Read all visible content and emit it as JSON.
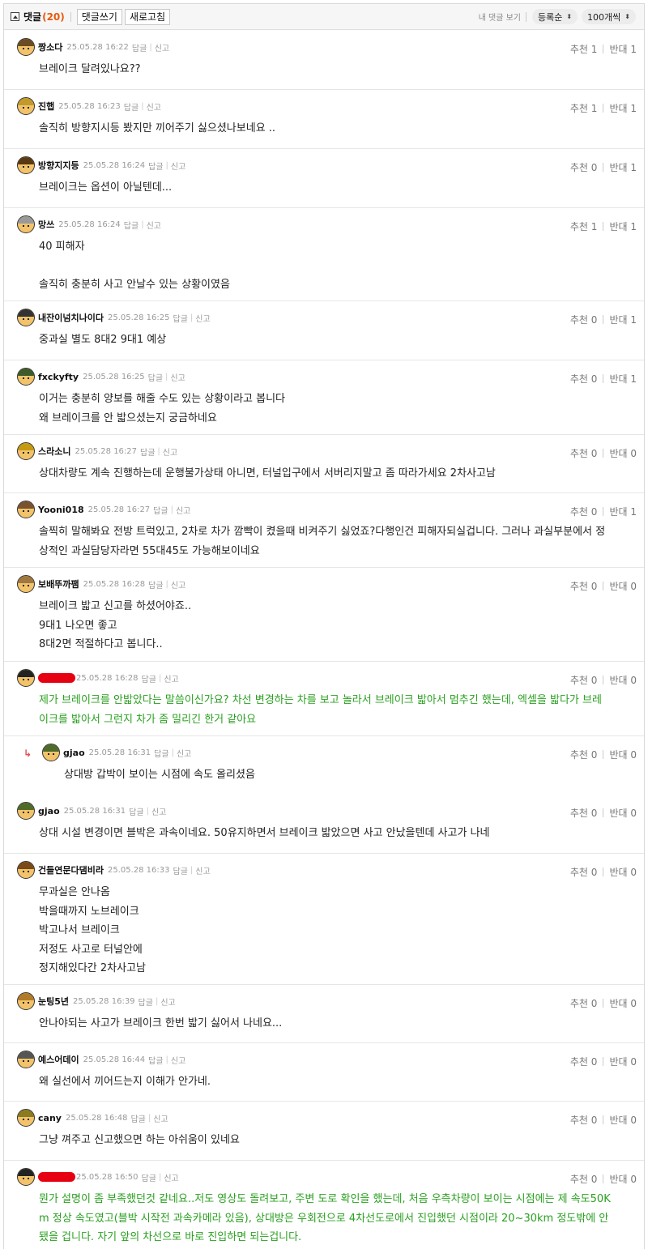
{
  "header": {
    "title": "댓글",
    "count": "(20)",
    "write_btn": "댓글쓰기",
    "refresh_btn": "새로고침",
    "my_comments": "내 댓글 보기",
    "sort_select": "등록순",
    "per_page_select": "100개씩"
  },
  "labels": {
    "reply": "답글",
    "report": "신고",
    "up": "추천",
    "down": "반대"
  },
  "colors": {
    "count": "#e8590c",
    "author_highlight": "#2aa020",
    "redacted": "#e60012"
  },
  "comments": [
    {
      "nick": "짱소다",
      "date": "25.05.28 16:22",
      "up": "1",
      "down": "1",
      "lines": [
        "브레이크 달려있나요??"
      ]
    },
    {
      "nick": "진햅",
      "date": "25.05.28 16:23",
      "up": "1",
      "down": "1",
      "lines": [
        "솔직히 방향지시등 봤지만 끼어주기 싫으셨나보네요 .."
      ]
    },
    {
      "nick": "방향지지등",
      "date": "25.05.28 16:24",
      "up": "0",
      "down": "1",
      "lines": [
        "브레이크는 옵션이 아닐텐데..."
      ]
    },
    {
      "nick": "망쓰",
      "date": "25.05.28 16:24",
      "up": "1",
      "down": "1",
      "lines": [
        "40 피해자",
        "",
        "솔직히 충분히 사고 안날수 있는 상황이였음"
      ]
    },
    {
      "nick": "내잔이넘치나이다",
      "date": "25.05.28 16:25",
      "up": "0",
      "down": "1",
      "lines": [
        "중과실 별도 8대2 9대1 예상"
      ]
    },
    {
      "nick": "fxckyfty",
      "date": "25.05.28 16:25",
      "up": "0",
      "down": "1",
      "lines": [
        "이거는 충분히 양보를 해줄 수도 있는 상황이라고 봅니다",
        "왜 브레이크를 안 밟으셨는지 궁금하네요"
      ]
    },
    {
      "nick": "스라소니",
      "date": "25.05.28 16:27",
      "up": "0",
      "down": "0",
      "lines": [
        "상대차량도 계속 진행하는데 운행불가상태 아니면, 터널입구에서 서버리지말고 좀 따라가세요 2차사고남"
      ]
    },
    {
      "nick": "Yooni018",
      "date": "25.05.28 16:27",
      "up": "0",
      "down": "1",
      "lines": [
        "솔찍히 말해봐요 전방 트럭있고, 2차로 차가 깜빡이 켰을때 비켜주기 싫었죠?다행인건 피해자되실겁니다. 그러나 과실부분에서 정",
        "상적인 과실담당자라면 55대45도 가능해보이네요"
      ]
    },
    {
      "nick": "보배뚜까팸",
      "date": "25.05.28 16:28",
      "up": "0",
      "down": "0",
      "lines": [
        "브레이크 밟고 신고를 하셨어야죠..",
        "9대1 나오면 좋고",
        "8대2면 적절하다고 봅니다.."
      ]
    },
    {
      "nick": "",
      "date": "25.05.28 16:28",
      "up": "0",
      "down": "0",
      "lines": [
        "제가 브레이크를 안밟았다는 말씀이신가요? 차선 변경하는 차를 보고 놀라서 브레이크 밟아서 멈추긴 했는데, 엑셀을 밟다가 브레",
        "이크를 밟아서 그런지 차가 좀 밀리긴 한거 같아요"
      ]
    },
    {
      "nick": "gjao",
      "date": "25.05.28 16:31",
      "up": "0",
      "down": "0",
      "lines": [
        "상대방 갑박이 보이는 시점에 속도 올리셨음"
      ]
    },
    {
      "nick": "gjao",
      "date": "25.05.28 16:31",
      "up": "0",
      "down": "0",
      "lines": [
        "상대 시설 변경이면 블박은 과속이네요. 50유지하면서 브레이크 밟았으면 사고 안났을텐데 사고가 나네"
      ]
    },
    {
      "nick": "건들연문다댐비라",
      "date": "25.05.28 16:33",
      "up": "0",
      "down": "0",
      "lines": [
        "무과실은 안나옴",
        "박을때까지 노브레이크",
        "박고나서 브레이크",
        "저정도 사고로 터널안에",
        "정지해있다간 2차사고남"
      ]
    },
    {
      "nick": "눈팅5년",
      "date": "25.05.28 16:39",
      "up": "0",
      "down": "0",
      "lines": [
        "안나야되는 사고가 브레이크 한번 밟기 싫어서 나네요..."
      ]
    },
    {
      "nick": "예스어데이",
      "date": "25.05.28 16:44",
      "up": "0",
      "down": "0",
      "lines": [
        "왜 실선에서 끼어드는지 이해가 안가네."
      ]
    },
    {
      "nick": "cany",
      "date": "25.05.28 16:48",
      "up": "0",
      "down": "0",
      "lines": [
        "그냥 껴주고 신고했으면 하는 아쉬움이 있네요"
      ]
    },
    {
      "nick": "",
      "date": "25.05.28 16:50",
      "up": "0",
      "down": "0",
      "lines": [
        "뭔가 설명이 좀 부족했던것 같네요..저도 영상도 돌려보고, 주변 도로 확인을 했는데, 처음 우측차량이 보이는 시점에는 제 속도50K",
        "m 정상 속도였고(블박 시작전 과속카메라 있음), 상대방은 우회전으로 4차선도로에서 진입했던 시점이라 20~30km 정도밖에 안",
        "됐을 겁니다. 자기 앞의 차선으로 바로 진입하면 되는겁니다."
      ]
    }
  ]
}
